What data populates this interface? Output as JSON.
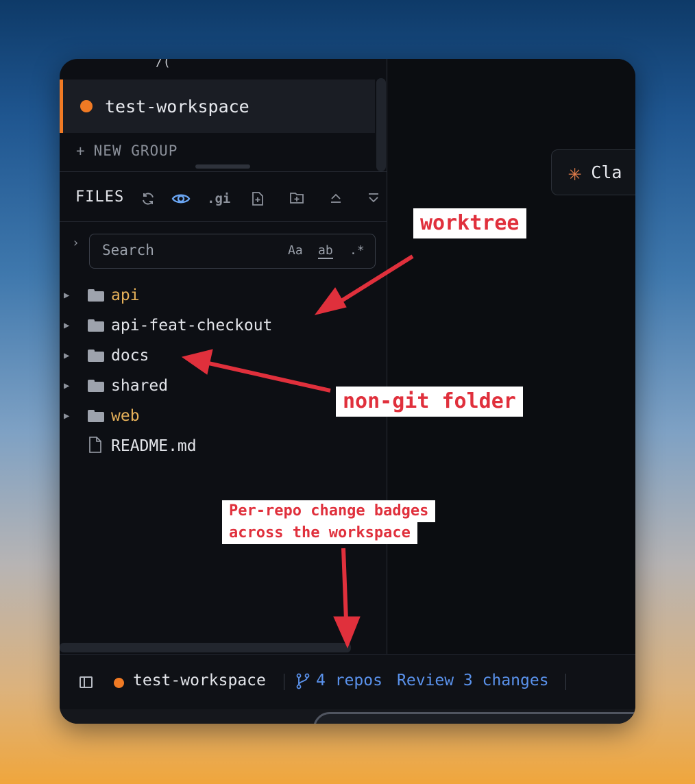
{
  "sidebar": {
    "top_glyph": "/(",
    "workspace": {
      "name": "test-workspace",
      "color": "#f07a24"
    },
    "new_group_label": "NEW GROUP",
    "files_title": "FILES",
    "toolbar": {
      "gitignore_label": ".gi",
      "icons": [
        "refresh-icon",
        "eye-icon",
        "new-file-icon",
        "new-folder-icon",
        "collapse-up-icon",
        "collapse-down-icon"
      ]
    },
    "search": {
      "placeholder": "Search",
      "match_case": "Aa",
      "whole_word": "ab",
      "regex": ".*"
    },
    "tree": [
      {
        "label": "api",
        "type": "folder",
        "is_repo": true
      },
      {
        "label": "api-feat-checkout",
        "type": "folder",
        "is_repo": false
      },
      {
        "label": "docs",
        "type": "folder",
        "is_repo": false
      },
      {
        "label": "shared",
        "type": "folder",
        "is_repo": false
      },
      {
        "label": "web",
        "type": "folder",
        "is_repo": true
      },
      {
        "label": "README.md",
        "type": "file",
        "is_repo": false
      }
    ]
  },
  "main": {
    "agent_button_label": "Cla"
  },
  "status_bar": {
    "workspace_name": "test-workspace",
    "repos_label": "4 repos",
    "review_label": "Review 3 changes",
    "link_color": "#5a92ec"
  },
  "annotations": {
    "worktree": "worktree",
    "non_git": "non-git folder",
    "badges_line1": "Per-repo change badges",
    "badges_line2": "across the workspace",
    "color": "#e0303c"
  }
}
